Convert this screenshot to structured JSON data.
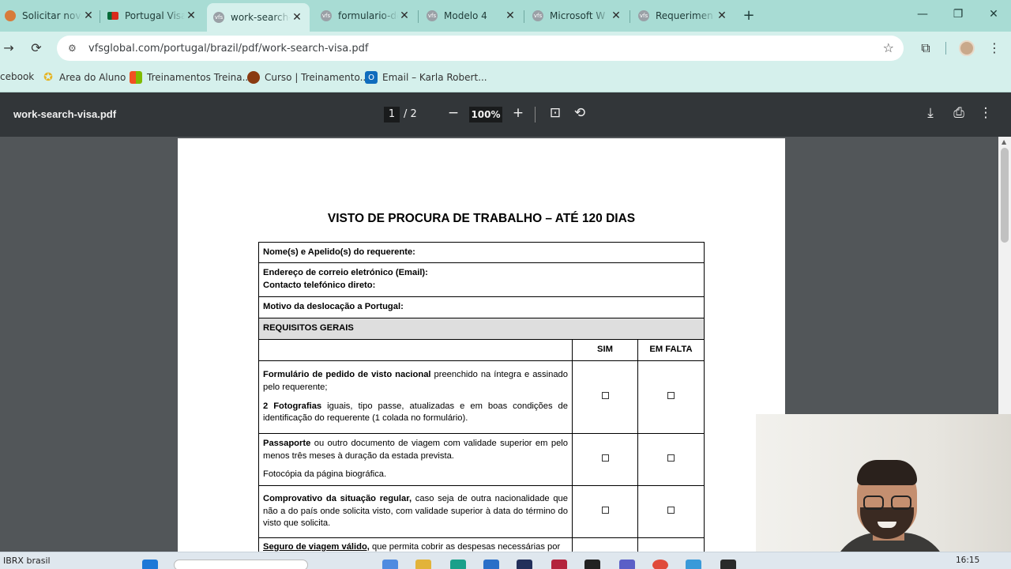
{
  "tabs": [
    {
      "title": "Solicitar novo",
      "icon": "bunny-favicon-icon",
      "color": "#d77b3a"
    },
    {
      "title": "Portugal Visa",
      "icon": "portugal-flag-icon",
      "color": "#c8102e"
    },
    {
      "title": "work-search-",
      "icon": "vfs-favicon-icon",
      "color": "#8e8e8e"
    },
    {
      "title": "formulario-de",
      "icon": "vfs-favicon-icon",
      "color": "#8e8e8e"
    },
    {
      "title": "Modelo 4",
      "icon": "vfs-favicon-icon",
      "color": "#8e8e8e"
    },
    {
      "title": "Microsoft W",
      "icon": "vfs-favicon-icon",
      "color": "#8e8e8e"
    },
    {
      "title": "Requerimen",
      "icon": "vfs-favicon-icon",
      "color": "#8e8e8e"
    }
  ],
  "close_glyph": "✕",
  "newtab_glyph": "+",
  "window": {
    "minimize": "—",
    "restore": "❐",
    "close": "✕"
  },
  "toolbar": {
    "forward": "→",
    "reload": "⟳",
    "url": "vfsglobal.com/portugal/brazil/pdf/work-search-visa.pdf",
    "star": "☆",
    "extensions": "⧉",
    "menu": "⋮"
  },
  "bookmarks": [
    {
      "label": "cebook"
    },
    {
      "label": "Area do Aluno",
      "color": "#e6b422"
    },
    {
      "label": "Treinamentos Treina...",
      "color": "#f25022"
    },
    {
      "label": "Curso | Treinamento...",
      "color": "#8a3b12"
    },
    {
      "label": "Email – Karla Robert...",
      "color": "#0f6cbd"
    }
  ],
  "pdf": {
    "filename": "work-search-visa.pdf",
    "page": "1",
    "page_total": "/ 2",
    "zoom": "100%",
    "minus": "−",
    "plus": "+",
    "fit": "⊡",
    "rotate": "⟲",
    "download": "⤓",
    "print": "⎙",
    "more": "⋮"
  },
  "document": {
    "title": "VISTO DE PROCURA DE TRABALHO – ATÉ 120 DIAS",
    "name_row": "Nome(s) e Apelido(s) do requerente:",
    "email_row": "Endereço de correio eletrónico (Email):",
    "phone_row": "Contacto telefónico direto:",
    "motive_row": "Motivo da deslocação a Portugal:",
    "section": "REQUISITOS GERAIS",
    "col_sim": "SIM",
    "col_falta": "EM FALTA",
    "req1_bold": "Formulário de pedido de visto nacional",
    "req1_text": " preenchido na íntegra e assinado pelo requerente;",
    "req1b_bold": "2 Fotografias",
    "req1b_text": " iguais, tipo passe, atualizadas e em boas condições de identificação do requerente (1 colada no formulário).",
    "req2_bold": "Passaporte",
    "req2_text": " ou outro documento de viagem com validade superior em pelo menos três meses à duração da estada prevista.",
    "req2b_text": "Fotocópia da página biográfica.",
    "req3_bold": "Comprovativo da situação regular,",
    "req3_text": " caso seja de outra nacionalidade que não a do país onde solicita visto, com validade superior à data do término do visto que solicita.",
    "req4_bold": "Seguro de viagem válido,",
    "req4_text": " que permita cobrir as despesas necessárias por"
  },
  "taskbar": {
    "weather": "IBRX brasil",
    "clock": "16:15"
  }
}
